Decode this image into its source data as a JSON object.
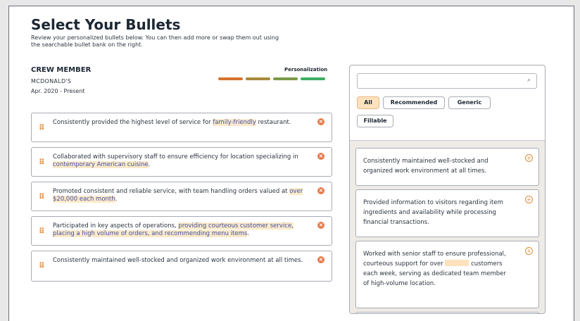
{
  "page": {
    "title": "Select Your Bullets",
    "subtitle": "Review your personalized bullets below. You can then add more or swap them out using the searchable bullet bank on the right."
  },
  "job": {
    "title": "CREW MEMBER",
    "employer": "MCDONALD'S",
    "dates": "Apr. 2020 - Present",
    "personalization_label": "Personalization",
    "personalization_colors": [
      "#d4742f",
      "#a88a3c",
      "#7a9a45",
      "#3fae63"
    ]
  },
  "bullets": [
    {
      "pre": "Consistently provided the highest level of service for ",
      "hl": "family-friendly",
      "post": " restaurant."
    },
    {
      "pre": "Collaborated with supervisory staff to ensure efficiency for location specializing in ",
      "hl": "contemporary American cuisine",
      "post": "."
    },
    {
      "pre": "Promoted consistent and reliable service, with team handling orders valued at ",
      "hl": "over $20,000 each month",
      "post": "."
    },
    {
      "pre": "Participated in key aspects of operations, ",
      "hl": "providing courteous customer service, placing a high volume of orders, and recommending menu items",
      "post": "."
    },
    {
      "pre": "Consistently maintained well-stocked and organized work environment at all times.",
      "hl": "",
      "post": ""
    }
  ],
  "bank": {
    "search_placeholder": "",
    "filters": [
      "All",
      "Recommended",
      "Generic",
      "Fillable"
    ],
    "active_filter": "All",
    "items": [
      {
        "text": "Consistently maintained well-stocked and organized work environment at all times."
      },
      {
        "text": "Provided information to visitors regarding item ingredients and availability while processing financial transactions."
      },
      {
        "pre": "Worked with senior staff to ensure professional, courteous support for over ",
        "post": " customers each week, serving as dedicated team member of high-volume location."
      }
    ]
  },
  "icons": {
    "drag": "drag-handle-icon",
    "remove": "remove-icon",
    "add": "add-icon",
    "search": "search-icon"
  },
  "colors": {
    "accent": "#e08a3c",
    "highlight_bg": "#fde9c8",
    "highlight_text": "#3b4fa8"
  }
}
